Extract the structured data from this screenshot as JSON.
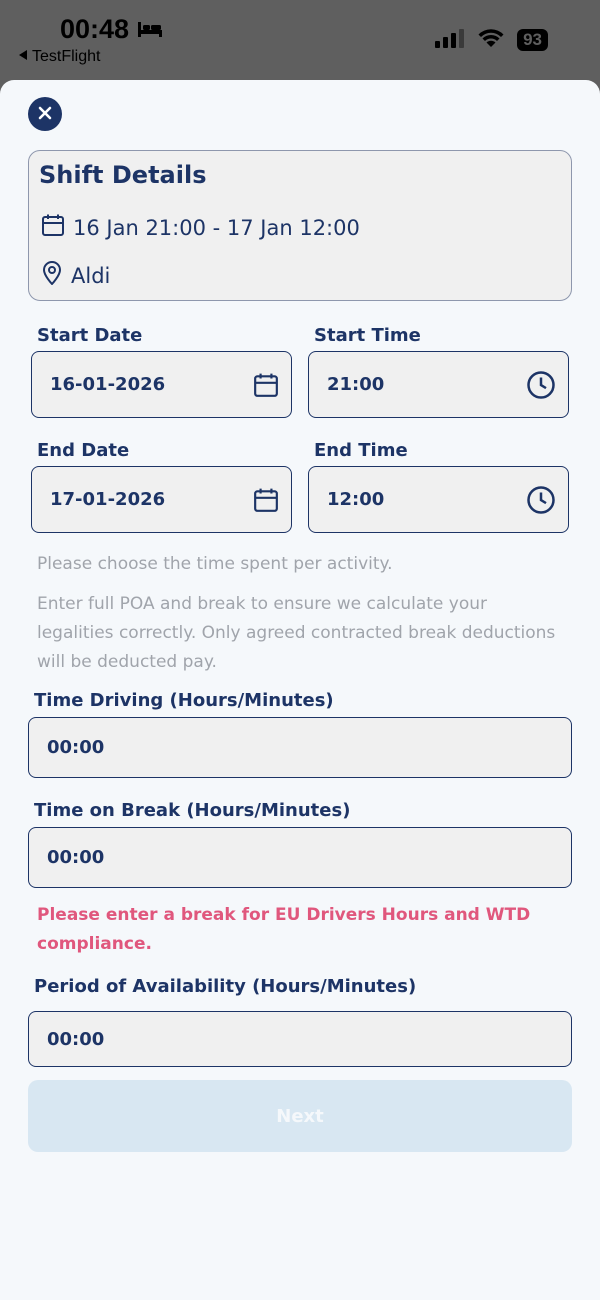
{
  "status_bar": {
    "time": "00:48",
    "back_app": "TestFlight",
    "battery": "93"
  },
  "shift": {
    "title": "Shift Details",
    "datetime": "16 Jan 21:00 - 17 Jan 12:00",
    "location": "Aldi"
  },
  "form": {
    "start_date": {
      "label": "Start Date",
      "value": "16-01-2026"
    },
    "start_time": {
      "label": "Start Time",
      "value": "21:00"
    },
    "end_date": {
      "label": "End Date",
      "value": "17-01-2026"
    },
    "end_time": {
      "label": "End Time",
      "value": "12:00"
    },
    "help_1": "Please choose the time spent per activity.",
    "help_2": "Enter full POA and break to ensure we calculate your legalities correctly. Only agreed contracted break deductions will be deducted pay.",
    "driving": {
      "label": "Time Driving (Hours/Minutes)",
      "value": "00:00"
    },
    "break": {
      "label": "Time on Break (Hours/Minutes)",
      "value": "00:00"
    },
    "break_error": "Please enter a break for EU Drivers Hours and WTD compliance.",
    "poa": {
      "label": "Period of Availability (Hours/Minutes)",
      "value": "00:00"
    },
    "next_label": "Next"
  },
  "colors": {
    "primary": "#1d3466",
    "error": "#e0577d",
    "disabled_button": "#d8e7f2"
  }
}
